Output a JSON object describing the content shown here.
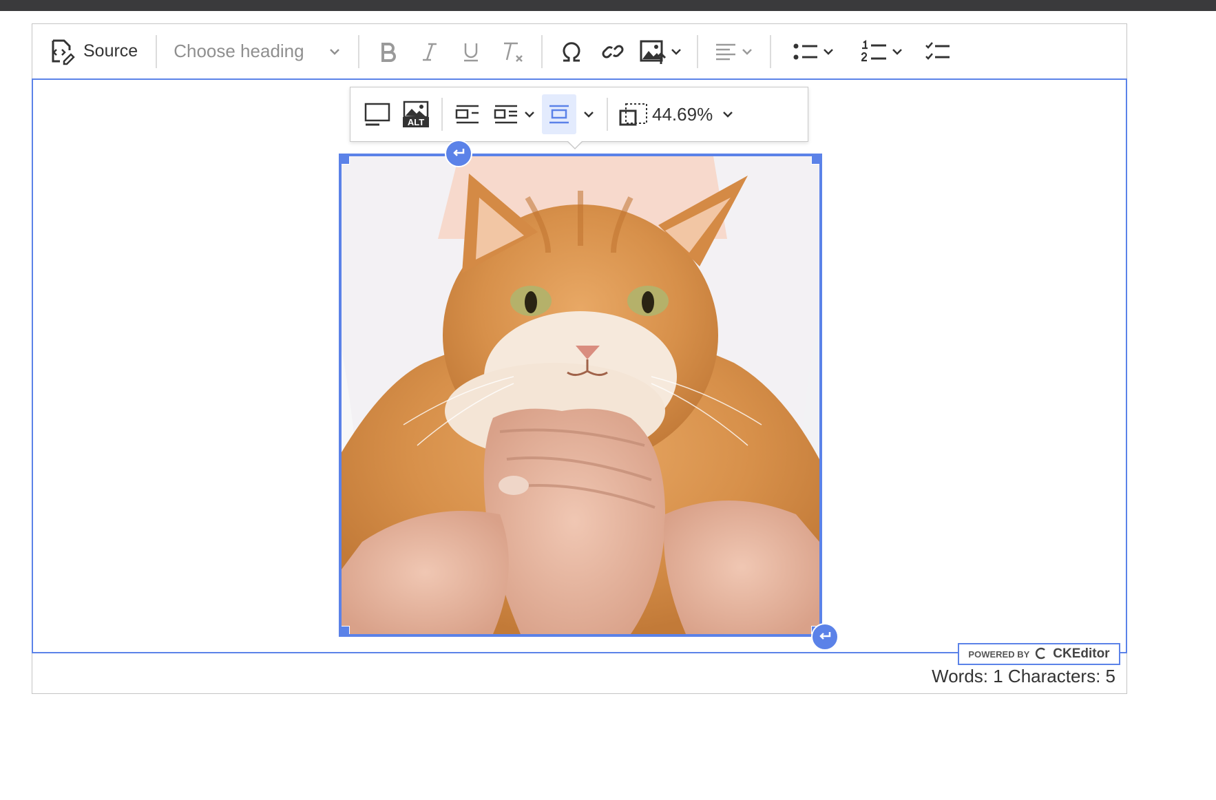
{
  "toolbar": {
    "source_label": "Source",
    "heading_placeholder": "Choose heading"
  },
  "image_toolbar": {
    "resize_value": "44.69%"
  },
  "footer": {
    "powered_by": "POWERED BY",
    "brand": "CKEditor",
    "word_count": "Words: 1 Characters: 5"
  },
  "colors": {
    "accent": "#5b82e8",
    "active_bg": "#e3ebfd"
  },
  "image": {
    "subject": "orange-tabby-cat-held-in-hands"
  }
}
